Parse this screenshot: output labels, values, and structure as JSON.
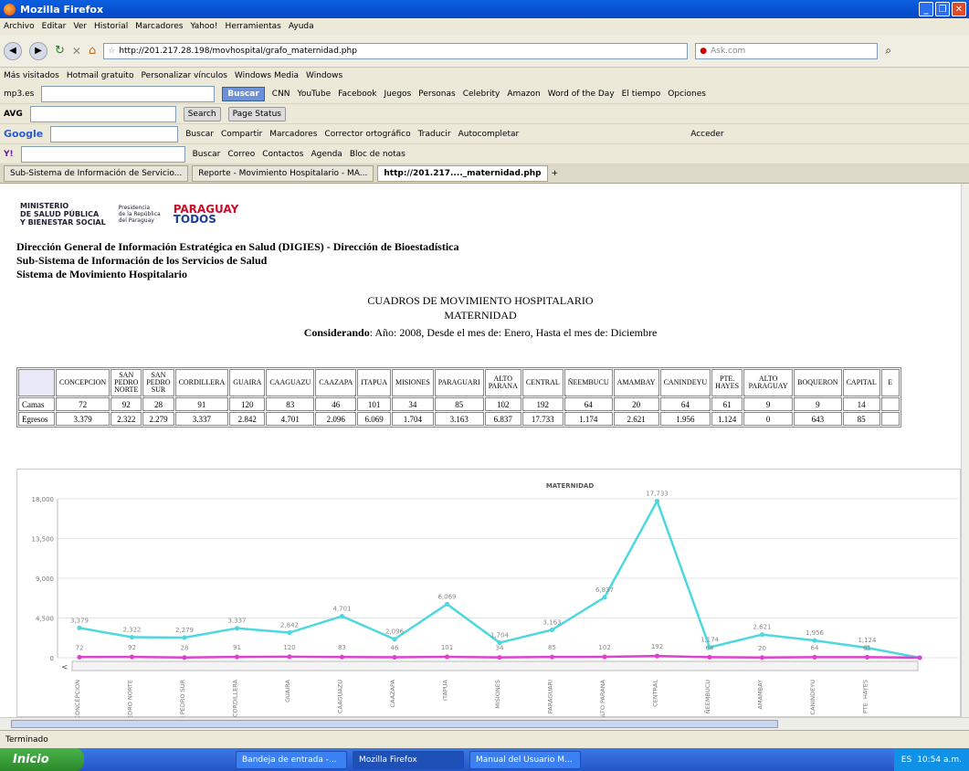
{
  "window": {
    "title": "Mozilla Firefox"
  },
  "menu": [
    "Archivo",
    "Editar",
    "Ver",
    "Historial",
    "Marcadores",
    "Yahoo!",
    "Herramientas",
    "Ayuda"
  ],
  "nav": {
    "url": "http://201.217.28.198/movhospital/grafo_maternidad.php",
    "search_placeholder": "Ask.com"
  },
  "bookmarks": [
    "Más visitados",
    "Hotmail gratuito",
    "Personalizar vínculos",
    "Windows Media",
    "Windows"
  ],
  "toolbar1": {
    "site": "mp3.es",
    "buscar": "Buscar",
    "items": [
      "CNN",
      "YouTube",
      "Facebook",
      "Juegos",
      "Personas",
      "Celebrity",
      "Amazon",
      "Word of the Day",
      "El tiempo",
      "Opciones"
    ]
  },
  "toolbar2": {
    "name": "AVG",
    "search": "Search",
    "page_status": "Page Status"
  },
  "toolbar3": {
    "name": "Google",
    "items": [
      "Buscar",
      "Compartir",
      "Marcadores",
      "Corrector ortográfico",
      "Traducir",
      "Autocompletar",
      "Acceder"
    ]
  },
  "toolbar4": {
    "items": [
      "Buscar",
      "Correo",
      "Contactos",
      "Agenda",
      "Bloc de notas"
    ]
  },
  "tabs": [
    {
      "label": "Sub-Sistema de Información de Servicio..."
    },
    {
      "label": "Reporte - Movimiento Hospitalario - MA..."
    },
    {
      "label": "http://201.217...._maternidad.php"
    }
  ],
  "page": {
    "ministerio": [
      "MINISTERIO",
      "DE SALUD PÚBLICA",
      "Y BIENESTAR SOCIAL"
    ],
    "presidencia": [
      "Presidencia",
      "de la República",
      "del Paraguay"
    ],
    "paraguay": "PARAGUAY",
    "todos": "TODOS",
    "header_lines": [
      "Dirección General de Información Estratégica en Salud (DIGIES) - Dirección de Bioestadística",
      "Sub-Sistema de Información de los Servicios de Salud",
      "Sistema de Movimiento Hospitalario"
    ],
    "title": "CUADROS DE MOVIMIENTO HOSPITALARIO",
    "subtitle": "MATERNIDAD",
    "considerando_label": "Considerando",
    "considerando_text": ": Año: 2008, Desde el mes de: Enero, Hasta el mes de: Diciembre"
  },
  "table": {
    "headers": [
      "CONCEPCION",
      "SAN PEDRO NORTE",
      "SAN PEDRO SUR",
      "CORDILLERA",
      "GUAIRA",
      "CAAGUAZU",
      "CAAZAPA",
      "ITAPUA",
      "MISIONES",
      "PARAGUARI",
      "ALTO PARANA",
      "CENTRAL",
      "ÑEEMBUCU",
      "AMAMBAY",
      "CANINDEYU",
      "PTE. HAYES",
      "ALTO PARAGUAY",
      "BOQUERON",
      "CAPITAL",
      "E"
    ],
    "rows": [
      {
        "label": "Camas",
        "values": [
          "72",
          "92",
          "28",
          "91",
          "120",
          "83",
          "46",
          "101",
          "34",
          "85",
          "102",
          "192",
          "64",
          "20",
          "64",
          "61",
          "9",
          "9",
          "14",
          ""
        ]
      },
      {
        "label": "Egresos",
        "values": [
          "3.379",
          "2.322",
          "2.279",
          "3.337",
          "2.842",
          "4.701",
          "2.096",
          "6.069",
          "1.704",
          "3.163",
          "6.837",
          "17.733",
          "1.174",
          "2.621",
          "1.956",
          "1.124",
          "0",
          "643",
          "85",
          ""
        ]
      }
    ]
  },
  "chart_data": {
    "type": "line",
    "title": "MATERNIDAD",
    "categories": [
      "CONCEPCION",
      "PEDRO NORTE",
      "AN PEDRO SUR",
      "CORDILLERA",
      "GUAIRA",
      "CAAGUAZU",
      "CAAZAPA",
      "ITAPUA",
      "MISIONES",
      "PARAGUARI",
      "ALTO PARANA",
      "CENTRAL",
      "ÑEEMBUCU",
      "AMAMBAY",
      "CANINDEYU",
      "PTE. HAYES"
    ],
    "series": [
      {
        "values": [
          3379,
          2322,
          2279,
          3337,
          2842,
          4701,
          2096,
          6069,
          1704,
          3163,
          6837,
          17733,
          1174,
          2621,
          1956,
          1124,
          0
        ],
        "labels": [
          "3,379",
          "2,322",
          "2,279",
          "3,337",
          "2,842",
          "4,701",
          "2,096",
          "6,069",
          "1,704",
          "3,163",
          "6,837",
          "17,733",
          "1,174",
          "2,621",
          "1,956",
          "1,124",
          ""
        ],
        "color": "#4dd8e0"
      },
      {
        "values": [
          72,
          92,
          28,
          91,
          120,
          83,
          46,
          101,
          34,
          85,
          102,
          192,
          64,
          20,
          64,
          61,
          9
        ],
        "labels": [
          "72",
          "92",
          "28",
          "91",
          "120",
          "83",
          "46",
          "101",
          "34",
          "85",
          "102",
          "192",
          "64",
          "20",
          "64",
          "61",
          ""
        ],
        "color": "#e040d0"
      }
    ],
    "ylim": [
      0,
      18000
    ],
    "yticks": [
      "18,000",
      "13,500",
      "9,000",
      "4,500",
      "0"
    ],
    "grid": true
  },
  "status": {
    "text": "Terminado"
  },
  "taskbar": {
    "start": "Inicio",
    "tasks": [
      "Bandeja de entrada -...",
      "Mozilla Firefox",
      "Manual del Usuario M..."
    ],
    "lang": "ES",
    "time": "10:54 a.m."
  }
}
